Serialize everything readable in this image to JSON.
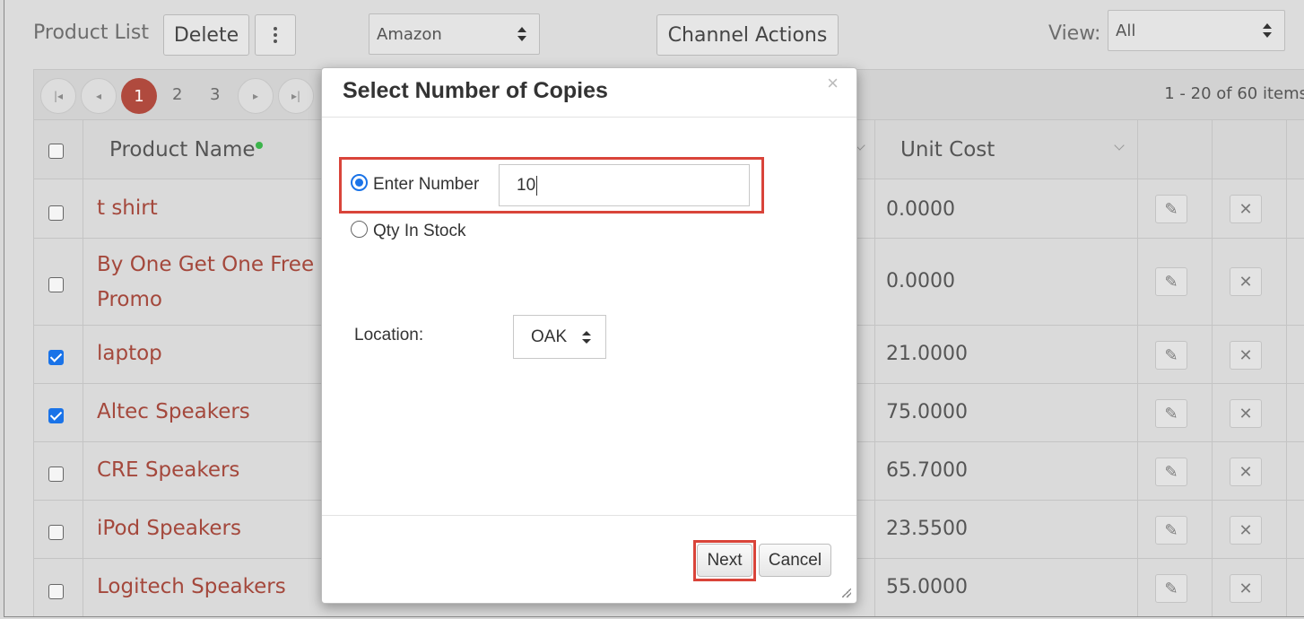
{
  "toolbar": {
    "title": "Product List",
    "delete_label": "Delete",
    "more_icon": "vertical-ellipsis-icon",
    "channel_select": "Amazon",
    "channel_actions_label": "Channel Actions",
    "view_label": "View:",
    "view_select": "All"
  },
  "pager": {
    "pages": [
      "1",
      "2",
      "3"
    ],
    "active_page": "1",
    "info": "1 - 20 of 60 items"
  },
  "grid": {
    "columns": {
      "product_name": "Product Name",
      "unit_cost": "Unit Cost"
    },
    "rows": [
      {
        "name": "t shirt",
        "cost": "0.0000",
        "checked": false
      },
      {
        "name": "By One Get One Free Promo",
        "cost": "0.0000",
        "checked": false
      },
      {
        "name": "laptop",
        "cost": "21.0000",
        "checked": true
      },
      {
        "name": "Altec Speakers",
        "cost": "75.0000",
        "checked": true
      },
      {
        "name": "CRE Speakers",
        "cost": "65.7000",
        "checked": false
      },
      {
        "name": "iPod Speakers",
        "cost": "23.5500",
        "checked": false
      },
      {
        "name": "Logitech Speakers",
        "cost": "55.0000",
        "checked": false
      }
    ]
  },
  "modal": {
    "title": "Select Number of Copies",
    "close_glyph": "×",
    "option_enter_number": "Enter Number",
    "option_qty_in_stock": "Qty In Stock",
    "number_value": "10",
    "location_label": "Location:",
    "location_value": "OAK",
    "next_label": "Next",
    "cancel_label": "Cancel",
    "selected_option": "Enter Number"
  },
  "colors": {
    "accent_red": "#d9443a",
    "link_red": "#a4483c",
    "active_page": "#b04a3e",
    "checkbox_blue": "#1a73e8"
  }
}
